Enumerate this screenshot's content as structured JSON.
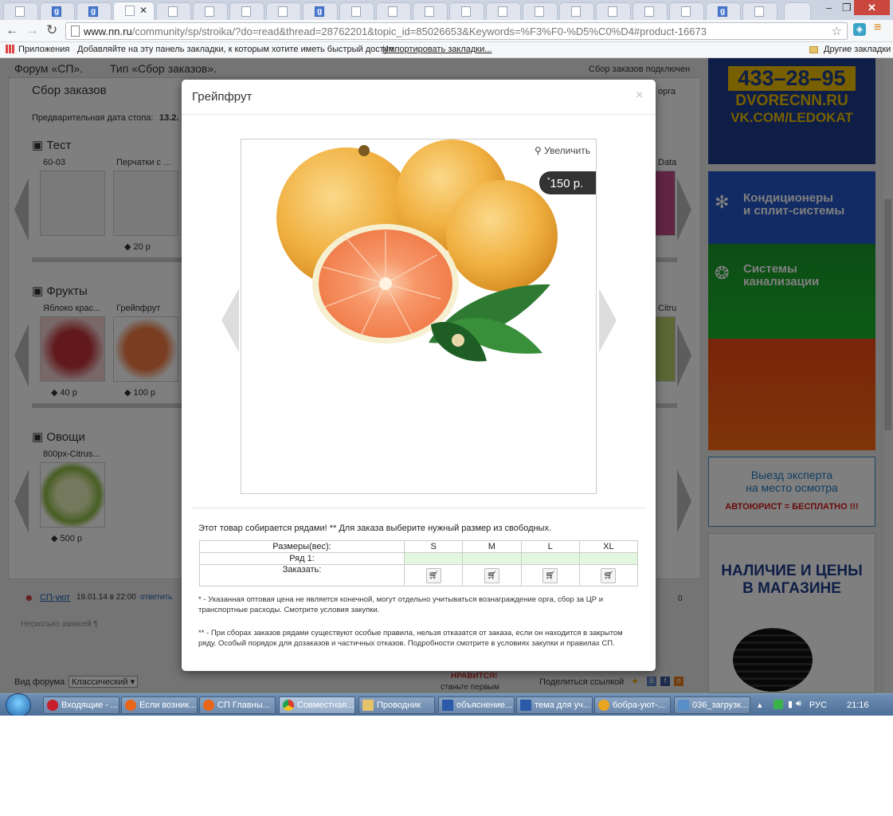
{
  "browser": {
    "url_host": "www.nn.ru",
    "url_path": "/community/sp/stroika/?do=read&thread=28762201&topic_id=85026653&Keywords=%F3%F0-%D5%C0%D4#product-16673",
    "bookmarks_apps": "Приложения",
    "bookmarks_hint": "Добавляйте на эту панель закладки, к которым хотите иметь быстрый доступ.",
    "bookmarks_import": "Импортировать закладки...",
    "bookmarks_other": "Другие закладки"
  },
  "page": {
    "breadcrumb_forum": "Форум «СП».",
    "breadcrumb_type": "Тип «Сбор заказов».",
    "status_right": "Сбор заказов подключен",
    "section_title": "Сбор заказов",
    "org_link": "орга",
    "stop_date_label": "Предварительная дата стопа:",
    "stop_date_value": "13.2.",
    "categories": [
      {
        "name": "Тест",
        "items": [
          {
            "name": "60-03",
            "price": ""
          },
          {
            "name": "Перчатки с ...",
            "price": "20 р"
          }
        ],
        "right_label": "Data"
      },
      {
        "name": "Фрукты",
        "items": [
          {
            "name": "Яблоко крас...",
            "price": "40 р"
          },
          {
            "name": "Грейпфрут",
            "price": "100 р"
          }
        ],
        "right_label": "Citru"
      },
      {
        "name": "Овощи",
        "items": [
          {
            "name": "800px-Citrus...",
            "price": "500 р"
          }
        ]
      }
    ],
    "comment_author": "СП-уют",
    "comment_date": "19.01.14 в 22:00",
    "comment_reply": "ответить",
    "comment_count": "0",
    "no_categories": "Несколько записей ¶",
    "view_label": "Вид форума",
    "view_value": "Классический",
    "likes": "НРАВИТСЯ!",
    "likes_sub": "станьте первым",
    "share": "Поделиться ссылкой"
  },
  "ads": {
    "phone": "433–28–95",
    "site1": "DVORECNN.RU",
    "site2": "VK.COM/LEDOKAT",
    "ac_line1": "Кондиционеры",
    "ac_line2": "и сплит-системы",
    "sewer_line1": "Системы",
    "sewer_line2": "канализации",
    "expert_line1": "Выезд эксперта",
    "expert_line2": "на место осмотра",
    "lawyer": "АВТОЮРИСТ = БЕСПЛАТНО !!!",
    "tires_line1": "НАЛИЧИЕ И ЦЕНЫ",
    "tires_line2": "В МАГАЗИНЕ"
  },
  "modal": {
    "title": "Грейпфрут",
    "close": "×",
    "zoom_label": "Увеличить",
    "price_mark": "*",
    "price": "150 р.",
    "note": "Этот товар собирается рядами! ** Для заказа выберите нужный размер из свободных.",
    "table": {
      "sizes_label": "Размеры(вес):",
      "sizes": [
        "S",
        "M",
        "L",
        "XL"
      ],
      "row_label": "Ряд 1:",
      "order_label": "Заказать:"
    },
    "footnote1": "* - Указанная оптовая цена не является конечной, могут отдельно учитываться вознаграждение орга, сбор за ЦР и транспортные расходы. Смотрите условия закупки.",
    "footnote2": "** - При сборах заказов рядами существуют особые правила, нельзя отказатся от заказа, если он находится в закрытом ряду. Особый порядок для дозаказов и частичных отказов. Подробности смотрите в условиях закупки и правилах СП."
  },
  "taskbar": {
    "tasks": [
      "Входящие - ...",
      "Если возник...",
      "СП Главны...",
      "Совместная...",
      "Проводник",
      "объяснение...",
      "тема для уч...",
      "бобра-уют-...",
      "036_загрузк..."
    ],
    "lang": "РУС",
    "time": "21:16"
  },
  "colors": {
    "accent": "#4a7bd4",
    "overlay": "rgba(0,0,0,0.5)",
    "close": "#c9473c"
  }
}
